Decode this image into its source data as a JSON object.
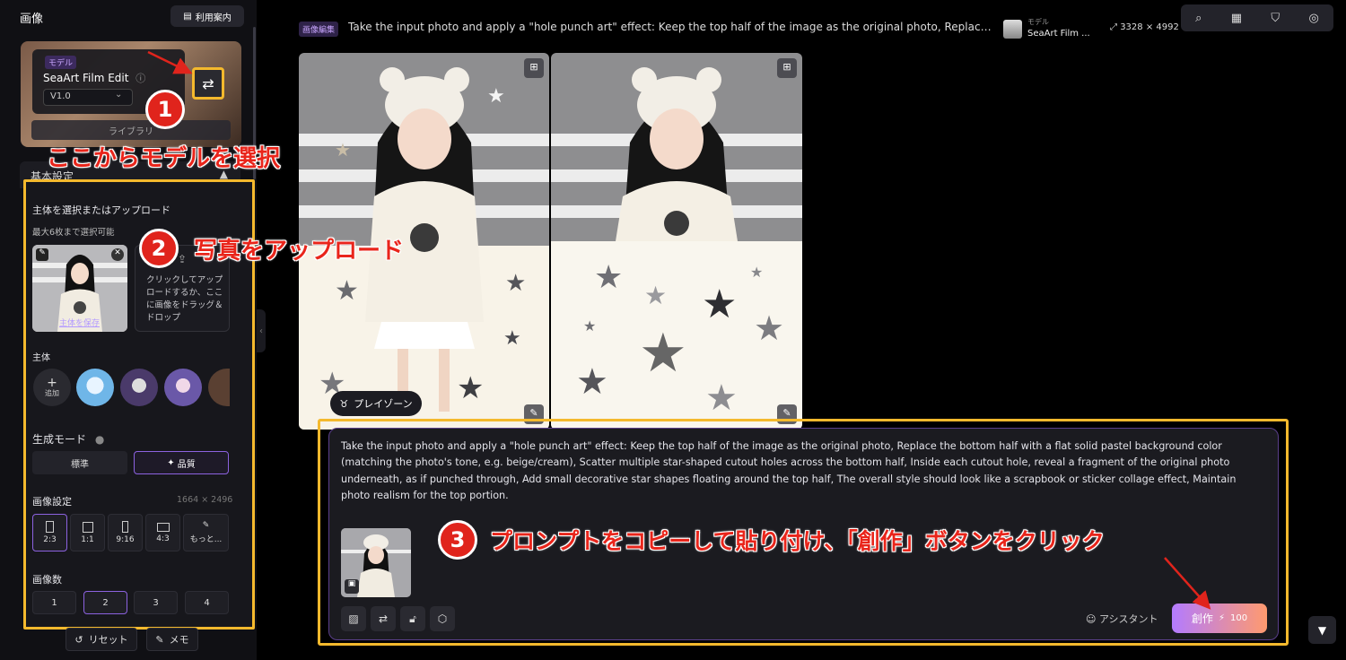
{
  "sidebar": {
    "title": "画像",
    "guide_label": "利用案内",
    "model": {
      "tag": "モデル",
      "name": "SeaArt Film Edit",
      "version": "V1.0",
      "library_label": "ライブラリ"
    },
    "basic_settings_label": "基本設定",
    "upload": {
      "title": "主体を選択またはアップロード",
      "limit": "最大6枚まで選択可能",
      "save_link": "主体を保存",
      "hint": "クリックしてアップロードするか、ここに画像をドラッグ＆ドロップ"
    },
    "subject": {
      "label": "主体",
      "add_label": "追加"
    },
    "gen_mode": {
      "label": "生成モード",
      "standard": "標準",
      "quality": "品質"
    },
    "image_settings": {
      "label": "画像設定",
      "size": "1664 × 2496",
      "ratios": [
        "2:3",
        "1:1",
        "9:16",
        "4:3",
        "もっと..."
      ]
    },
    "count": {
      "label": "画像数",
      "options": [
        "1",
        "2",
        "3",
        "4"
      ]
    },
    "reset_label": "リセット",
    "memo_label": "メモ"
  },
  "header": {
    "edit_tag": "画像編集",
    "prompt_preview": "Take the input photo and apply a \"hole punch art\" effect: Keep the top half of the image as the original photo, Replace the b...",
    "model_tag": "モデル",
    "model_name": "SeaArt Film ...",
    "resolution": "3328 × 4992"
  },
  "playzone_label": "プレイゾーン",
  "prompt": {
    "text": "Take the input photo and apply a \"hole punch art\" effect: Keep the top half of the image as the original photo, Replace the bottom half with a flat solid pastel background color (matching the photo's tone, e.g. beige/cream), Scatter multiple star-shaped cutout holes across the bottom half, Inside each cutout hole, reveal a fragment of the original photo underneath, as if punched through, Add small decorative star shapes floating around the top half, The overall style should look like a scrapbook or sticker collage effect, Maintain photo realism for the top portion.",
    "assistant_label": "アシスタント",
    "create_label": "創作",
    "create_cost": "100"
  },
  "annotations": {
    "step1_num": "1",
    "step1_text": "ここからモデルを選択",
    "step2_num": "2",
    "step2_text": "写真をアップロード",
    "step3_num": "3",
    "step3_text": "プロンプトをコピーして貼り付け、「創作」ボタンをクリック"
  },
  "colors": {
    "highlight": "#f4b92d",
    "annotation_red": "#e0241c",
    "accent_purple": "#b37bff"
  }
}
